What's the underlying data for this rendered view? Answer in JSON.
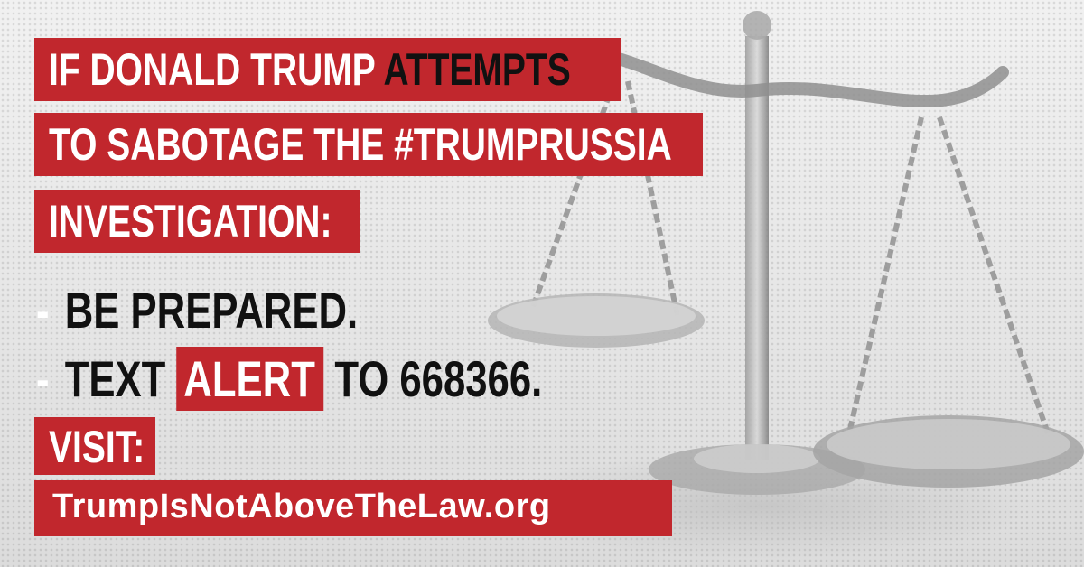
{
  "headline": {
    "line1_prefix": "IF DONALD TRUMP ",
    "line1_emphasis": "ATTEMPTS",
    "line2": "TO SABOTAGE THE #TRUMPRUSSIA",
    "line3": "INVESTIGATION:"
  },
  "bullets": {
    "dash": "-",
    "item1": "BE PREPARED.",
    "item2_prefix": "TEXT ",
    "item2_keyword": "ALERT",
    "item2_suffix": " TO 668366."
  },
  "visit": {
    "label": "VISIT:",
    "url": "TrumpIsNotAboveTheLaw.org"
  },
  "colors": {
    "brand_red": "#c1272d",
    "text_dark": "#111111",
    "text_light": "#ffffff"
  },
  "image": {
    "background_icon": "scales-of-justice-icon"
  }
}
